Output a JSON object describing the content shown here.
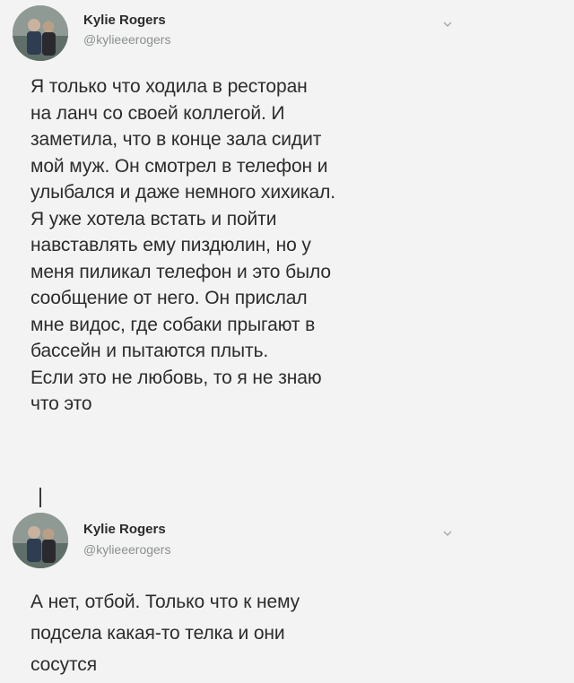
{
  "tweets": [
    {
      "name": "Kylie Rogers",
      "handle": "@kylieeerogers",
      "text": "Я только что ходила в ресторан\nна ланч со своей коллегой. И\nзаметила, что в конце зала сидит\nмой муж. Он смотрел в телефон и\nулыбался и даже немного хихикал.\nЯ уже хотела встать и пойти\nнавставлять ему пиздюлин, но у\nменя пиликал телефон и это было\nсообщение от него. Он прислал\nмне видос, где собаки прыгают в\nбассейн и пытаются плыть.\nЕсли это не любовь, то я не знаю\nчто это"
    },
    {
      "name": "Kylie Rogers",
      "handle": "@kylieeerogers",
      "text": "А нет, отбой. Только что к нему\nподсела какая-то телка и они\nсосутся"
    }
  ],
  "icons": {
    "more": "chevron-down-icon",
    "avatar": "profile-photo"
  },
  "colors": {
    "background": "#f2f3f2",
    "text": "#2c2c2c",
    "handle": "#8b8f92"
  }
}
